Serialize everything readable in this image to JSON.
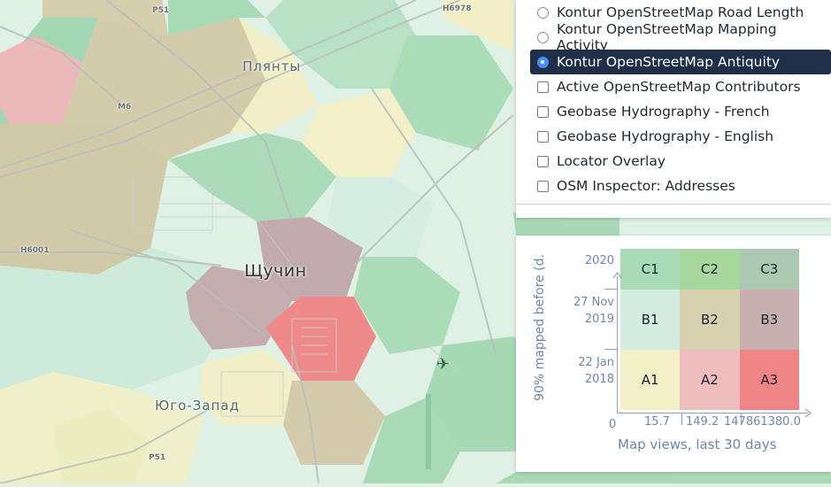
{
  "map": {
    "labels": {
      "plyanty": "Плянты",
      "shchuchyn": "Щучин",
      "yugo_zapad": "Юго-Запад"
    },
    "road_labels": {
      "p51_top": "P51",
      "h6978": "H6978",
      "m6": "M6",
      "h6001": "H6001",
      "p51_bottom": "P51"
    },
    "airport_icon": "airplane-icon"
  },
  "layers": {
    "items": [
      {
        "label": "Kontur OpenStreetMap Road Length",
        "control": "radio",
        "selected": false
      },
      {
        "label": "Kontur OpenStreetMap Mapping Activity",
        "control": "radio",
        "selected": false
      },
      {
        "label": "Kontur OpenStreetMap Antiquity",
        "control": "radio",
        "selected": true
      },
      {
        "label": "Active OpenStreetMap Contributors",
        "control": "checkbox",
        "selected": false
      },
      {
        "label": "Geobase Hydrography - French",
        "control": "checkbox",
        "selected": false
      },
      {
        "label": "Geobase Hydrography - English",
        "control": "checkbox",
        "selected": false
      },
      {
        "label": "Locator Overlay",
        "control": "checkbox",
        "selected": false
      },
      {
        "label": "OSM Inspector: Addresses",
        "control": "checkbox",
        "selected": false
      }
    ]
  },
  "legend": {
    "y_axis_label": "90% mapped before (d.",
    "x_axis_label": "Map views, last 30 days",
    "y_ticks": [
      {
        "line1": "2020",
        "line2": ""
      },
      {
        "line1": "27 Nov",
        "line2": "2019"
      },
      {
        "line1": "22 Jan",
        "line2": "2018"
      }
    ],
    "x_ticks": [
      "0",
      "15.7",
      "149.2",
      "147861380.0"
    ],
    "grid": [
      [
        {
          "label": "C1",
          "color": "#a9dbb6"
        },
        {
          "label": "C2",
          "color": "#a6d79c"
        },
        {
          "label": "C3",
          "color": "#adc8b0"
        }
      ],
      [
        {
          "label": "B1",
          "color": "#d4ede0"
        },
        {
          "label": "B2",
          "color": "#d7d1b0"
        },
        {
          "label": "B3",
          "color": "#c9b0b0"
        }
      ],
      [
        {
          "label": "A1",
          "color": "#f2f0c7"
        },
        {
          "label": "A2",
          "color": "#efbdbd"
        },
        {
          "label": "A3",
          "color": "#ef8585"
        }
      ]
    ]
  }
}
